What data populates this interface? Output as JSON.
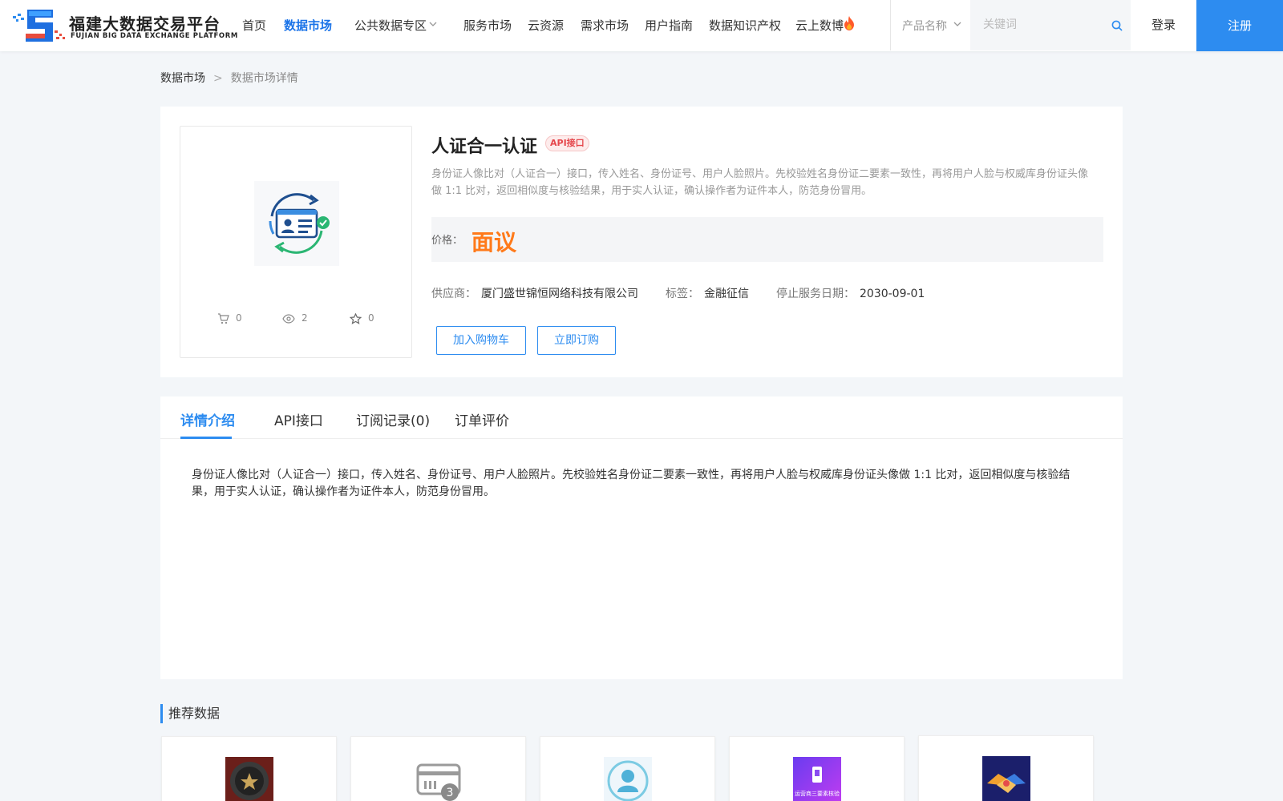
{
  "header": {
    "logo_title": "福建大数据交易平台",
    "logo_subtitle": "FUJIAN BIG DATA EXCHANGE  PLATFORM",
    "nav": [
      {
        "label": "首页"
      },
      {
        "label": "数据市场",
        "active": true
      },
      {
        "label": "公共数据专区",
        "dropdown": true
      },
      {
        "label": "服务市场"
      },
      {
        "label": "云资源"
      },
      {
        "label": "需求市场"
      },
      {
        "label": "用户指南"
      },
      {
        "label": "数据知识产权"
      },
      {
        "label": "云上数博",
        "icon": "fire-icon"
      }
    ],
    "search": {
      "category": "产品名称",
      "placeholder": "关键词",
      "value": ""
    },
    "login": "登录",
    "register": "注册"
  },
  "breadcrumb": [
    "数据市场",
    ">",
    "数据市场详情"
  ],
  "product": {
    "title": "人证合一认证",
    "badge": "API接口",
    "description": "身份证人像比对（人证合一）接口，传入姓名、身份证号、用户人脸照片。先校验姓名身份证二要素一致性，再将用户人脸与权威库身份证头像做 1:1 比对，返回相似度与核验结果，用于实人认证，确认操作者为证件本人，防范身份冒用。",
    "price_label": "价格：",
    "price_value": "面议",
    "stats": {
      "cart": "0",
      "views": "2",
      "favorites": "0"
    },
    "supplier_label": "供应商：",
    "supplier": "厦门盛世锦恒网络科技有限公司",
    "tag_label": "标签：",
    "tag": "金融征信",
    "stop_date_label": "停止服务日期：",
    "stop_date": "2030-09-01",
    "add_cart": "加入购物车",
    "subscribe": "立即订购"
  },
  "tabs": [
    {
      "label": "详情介绍",
      "active": true
    },
    {
      "label": "API接口"
    },
    {
      "label": "订阅记录(0)"
    },
    {
      "label": "订单评价"
    }
  ],
  "detail_text": "身份证人像比对（人证合一）接口，传入姓名、身份证号、用户人脸照片。先校验姓名身份证二要素一致性，再将用户人脸与权威库身份证头像做 1:1 比对，返回相似度与核验结果，用于实人认证，确认操作者为证件本人，防范身份冒用。",
  "recommend": {
    "title": "推荐数据",
    "items": [
      {
        "icon": "badge-icon"
      },
      {
        "icon": "card-count-icon",
        "badge": "3"
      },
      {
        "icon": "face-avatar-icon"
      },
      {
        "icon": "phone-verify-icon",
        "caption": "运营商三要素核验"
      },
      {
        "icon": "handshake-icon"
      }
    ]
  },
  "colors": {
    "primary": "#2d8cf0",
    "price": "#ff7a1a",
    "badge": "#e5484d"
  }
}
